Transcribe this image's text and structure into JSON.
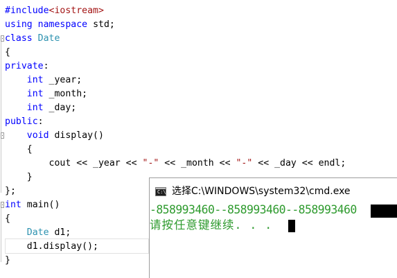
{
  "editor": {
    "lines": [
      {
        "segments": [
          {
            "cls": "kw",
            "text": "#include"
          },
          {
            "cls": "inc",
            "text": "<iostream>"
          }
        ]
      },
      {
        "segments": [
          {
            "cls": "kw",
            "text": "using"
          },
          {
            "cls": "",
            "text": " "
          },
          {
            "cls": "kw",
            "text": "namespace"
          },
          {
            "cls": "",
            "text": " std;"
          }
        ]
      },
      {
        "segments": [
          {
            "cls": "kw",
            "text": "class"
          },
          {
            "cls": "",
            "text": " "
          },
          {
            "cls": "typ",
            "text": "Date"
          }
        ]
      },
      {
        "segments": [
          {
            "cls": "",
            "text": "{"
          }
        ]
      },
      {
        "segments": [
          {
            "cls": "kw",
            "text": "private"
          },
          {
            "cls": "",
            "text": ":"
          }
        ]
      },
      {
        "segments": [
          {
            "cls": "",
            "text": "    "
          },
          {
            "cls": "kw",
            "text": "int"
          },
          {
            "cls": "",
            "text": " _year;"
          }
        ]
      },
      {
        "segments": [
          {
            "cls": "",
            "text": "    "
          },
          {
            "cls": "kw",
            "text": "int"
          },
          {
            "cls": "",
            "text": " _month;"
          }
        ]
      },
      {
        "segments": [
          {
            "cls": "",
            "text": "    "
          },
          {
            "cls": "kw",
            "text": "int"
          },
          {
            "cls": "",
            "text": " _day;"
          }
        ]
      },
      {
        "segments": [
          {
            "cls": "kw",
            "text": "public"
          },
          {
            "cls": "",
            "text": ":"
          }
        ]
      },
      {
        "segments": [
          {
            "cls": "",
            "text": "    "
          },
          {
            "cls": "kw",
            "text": "void"
          },
          {
            "cls": "",
            "text": " display()"
          }
        ]
      },
      {
        "segments": [
          {
            "cls": "",
            "text": "    {"
          }
        ]
      },
      {
        "segments": [
          {
            "cls": "",
            "text": "        cout << _year << "
          },
          {
            "cls": "str",
            "text": "\"-\""
          },
          {
            "cls": "",
            "text": " << _month << "
          },
          {
            "cls": "str",
            "text": "\"-\""
          },
          {
            "cls": "",
            "text": " << _day << endl;"
          }
        ]
      },
      {
        "segments": [
          {
            "cls": "",
            "text": "    }"
          }
        ]
      },
      {
        "segments": [
          {
            "cls": "",
            "text": "};"
          }
        ]
      },
      {
        "segments": [
          {
            "cls": "kw",
            "text": "int"
          },
          {
            "cls": "",
            "text": " main()"
          }
        ]
      },
      {
        "segments": [
          {
            "cls": "",
            "text": "{"
          }
        ]
      },
      {
        "segments": [
          {
            "cls": "",
            "text": "    "
          },
          {
            "cls": "typ",
            "text": "Date"
          },
          {
            "cls": "",
            "text": " d1;"
          }
        ]
      },
      {
        "segments": [
          {
            "cls": "",
            "text": "    d1.display();"
          }
        ]
      },
      {
        "segments": [
          {
            "cls": "",
            "text": "}"
          }
        ]
      }
    ]
  },
  "console": {
    "title": "选择C:\\WINDOWS\\system32\\cmd.exe",
    "output_line_1": "-858993460--858993460--858993460",
    "output_line_2": "请按任意键继续. . .",
    "text_color": "#2f9b2f",
    "icon": "cmd-icon"
  }
}
